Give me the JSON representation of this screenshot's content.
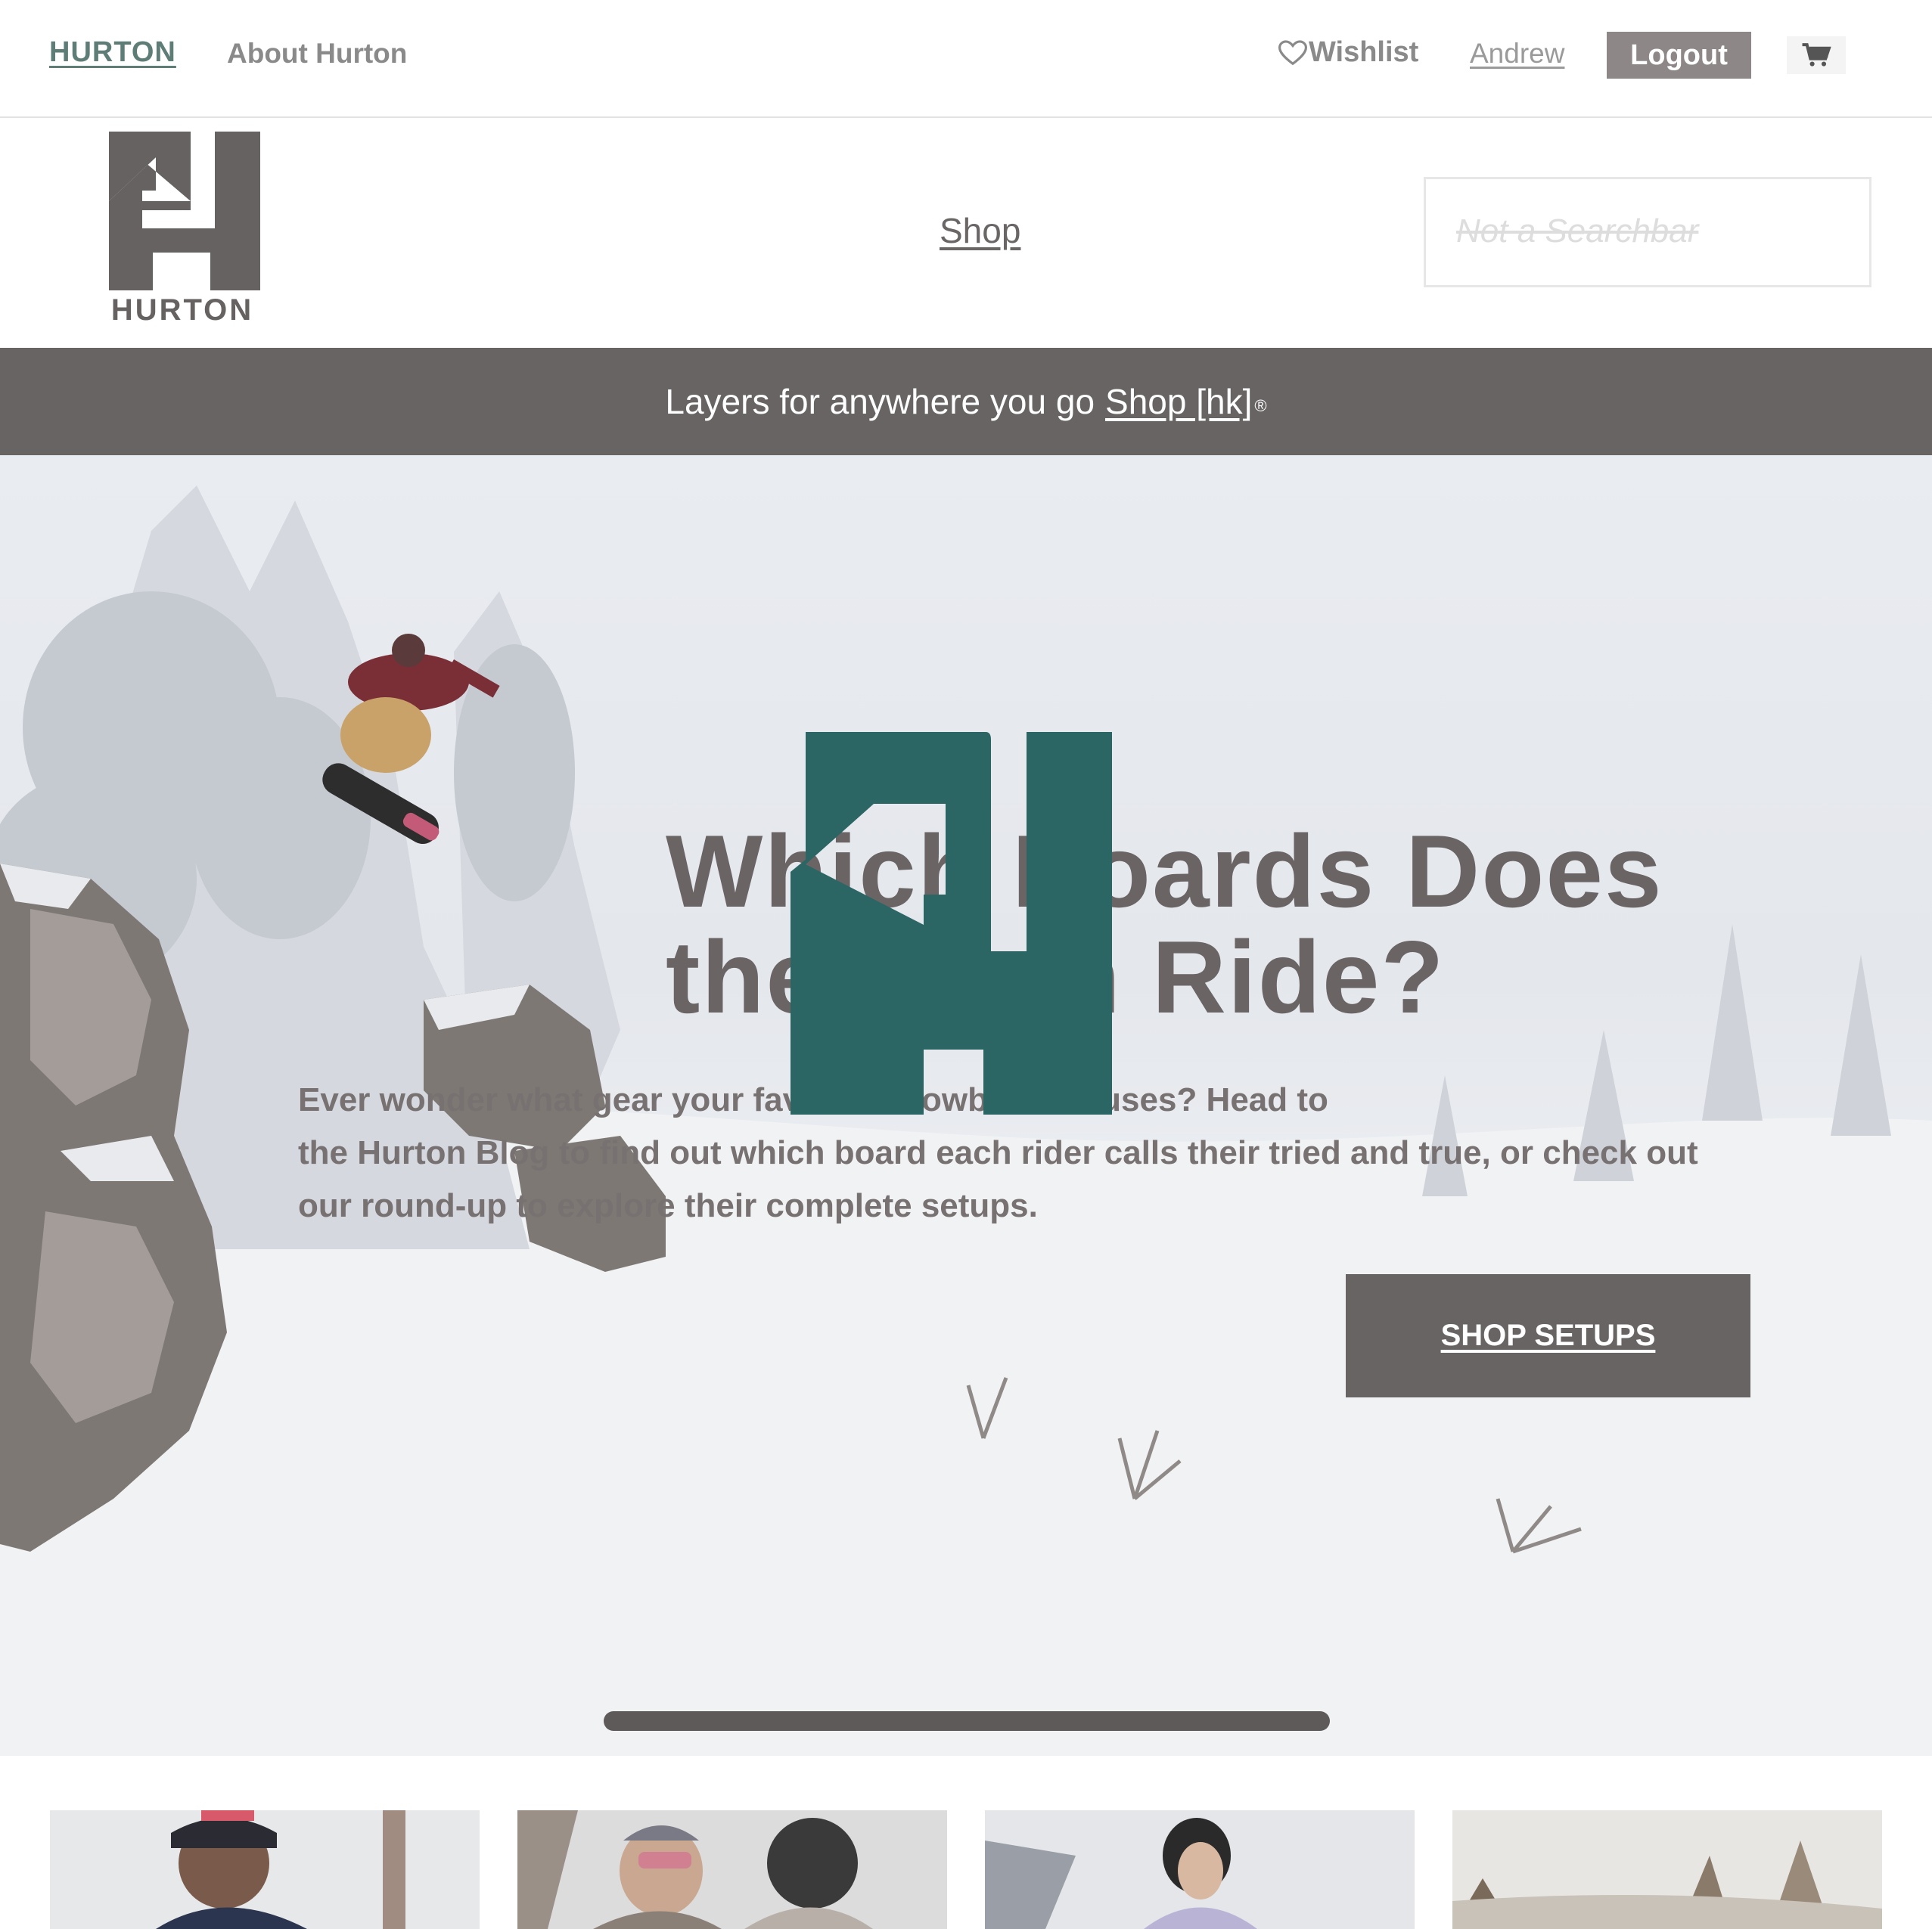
{
  "topbar": {
    "brand": "HURTON",
    "about": "About Hurton",
    "wishlist": "Wishlist",
    "user": "Andrew",
    "logout": "Logout",
    "wishlist_icon": "heart-icon",
    "cart_icon": "cart-icon"
  },
  "header": {
    "logo_text": "HURTON",
    "shop": "Shop",
    "search_placeholder": "Not a Searchbar"
  },
  "promo": {
    "text": "Layers for anywhere you go",
    "link": "Shop [hk]",
    "mark": "®"
  },
  "hero": {
    "title_line1": "Which Boards Does",
    "title_line2": "the Team Ride?",
    "desc_line1": "Ever wonder what gear your favorite snowboarder uses? Head to",
    "desc_line2": "the Hurton Blog to find out which board each rider calls their tried and true, or check out",
    "desc_line3": "our round-up to explore their complete setups.",
    "cta": "SHOP SETUPS"
  },
  "colors": {
    "brand_green": "#2c6664",
    "banner_gray": "#686464",
    "logout_gray": "#8e8787",
    "brand_link": "#5e7d77"
  }
}
